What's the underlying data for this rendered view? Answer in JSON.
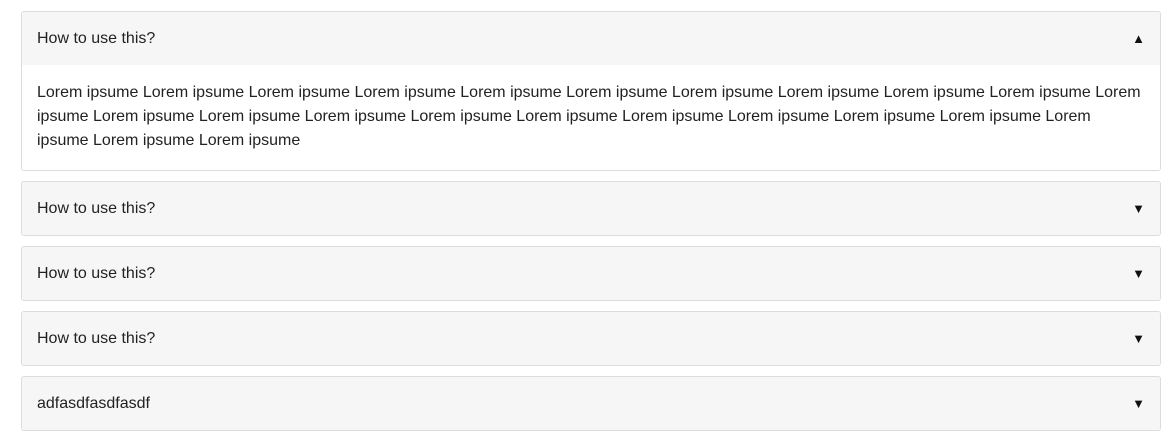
{
  "accordion": {
    "items": [
      {
        "title": "How to use this?",
        "expanded": true,
        "icon": "▲",
        "icon_name": "caret-up-icon",
        "body": "Lorem ipsume Lorem ipsume Lorem ipsume Lorem ipsume Lorem ipsume Lorem ipsume Lorem ipsume Lorem ipsume Lorem ipsume Lorem ipsume Lorem ipsume Lorem ipsume Lorem ipsume Lorem ipsume Lorem ipsume Lorem ipsume Lorem ipsume Lorem ipsume Lorem ipsume Lorem ipsume Lorem ipsume Lorem ipsume Lorem ipsume"
      },
      {
        "title": "How to use this?",
        "expanded": false,
        "icon": "▼",
        "icon_name": "caret-down-icon"
      },
      {
        "title": "How to use this?",
        "expanded": false,
        "icon": "▼",
        "icon_name": "caret-down-icon"
      },
      {
        "title": "How to use this?",
        "expanded": false,
        "icon": "▼",
        "icon_name": "caret-down-icon"
      },
      {
        "title": "adfasdfasdfasdf",
        "expanded": false,
        "icon": "▼",
        "icon_name": "caret-down-icon"
      }
    ]
  },
  "colors": {
    "header_bg": "#f6f6f6",
    "border": "#dcdcdc",
    "text": "#222222"
  }
}
